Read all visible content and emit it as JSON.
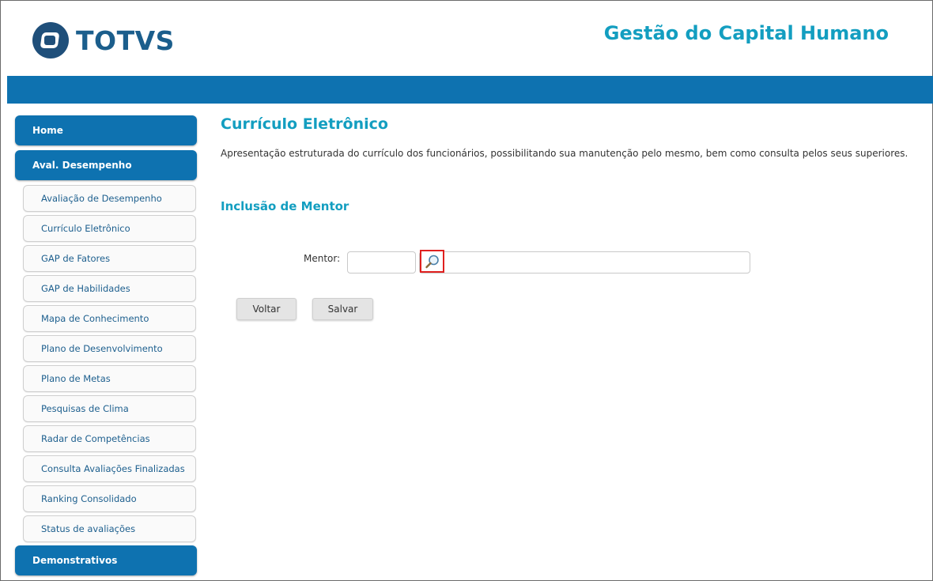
{
  "brand": {
    "logo_text": "TOTVS",
    "app_title": "Gestão do Capital Humano"
  },
  "colors": {
    "accent": "#139ec0",
    "bar": "#0e72b0",
    "link": "#1d5f8e",
    "highlight": "#e0201f"
  },
  "sidebar": {
    "home": "Home",
    "aval": "Aval. Desempenho",
    "items": [
      "Avaliação de Desempenho",
      "Currículo Eletrônico",
      "GAP de Fatores",
      "GAP de Habilidades",
      "Mapa de Conhecimento",
      "Plano de Desenvolvimento",
      "Plano de Metas",
      "Pesquisas de Clima",
      "Radar de Competências",
      "Consulta Avaliações Finalizadas",
      "Ranking Consolidado",
      "Status de avaliações"
    ],
    "demonstrativos": "Demonstrativos"
  },
  "main": {
    "title": "Currículo Eletrônico",
    "description": "Apresentação estruturada do currículo dos funcionários, possibilitando sua manutenção pelo mesmo, bem como consulta pelos seus superiores.",
    "section_title": "Inclusão de Mentor",
    "mentor_label": "Mentor:",
    "mentor_code_value": "",
    "mentor_name_value": "",
    "search_icon": "magnifier-icon"
  },
  "buttons": {
    "back": "Voltar",
    "save": "Salvar"
  }
}
